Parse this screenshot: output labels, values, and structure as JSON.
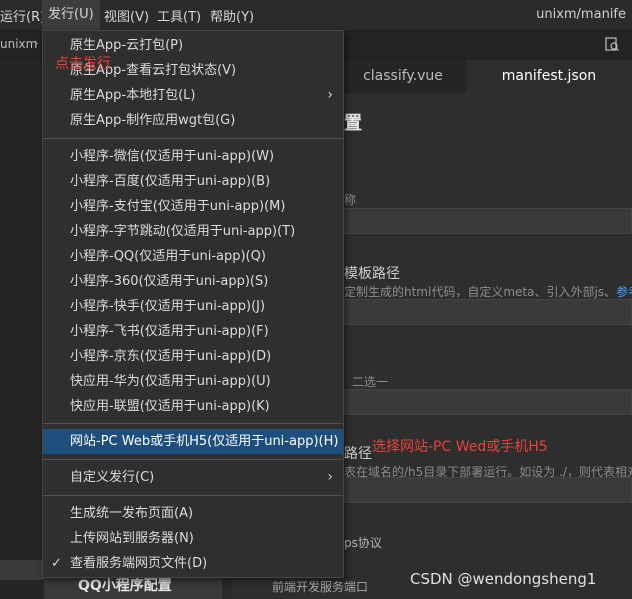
{
  "menubar": {
    "items": [
      "运行(R)",
      "发行(U)",
      "视图(V)",
      "工具(T)",
      "帮助(Y)"
    ],
    "window_title": "unixm/manife"
  },
  "breadcrumb": {
    "root": "unixm"
  },
  "tabs": [
    "classify.vue",
    "manifest.json"
  ],
  "dropdown": {
    "items": [
      "原生App-云打包(P)",
      "原生App-查看云打包状态(V)",
      "原生App-本地打包(L)",
      "原生App-制作应用wgt包(G)",
      "小程序-微信(仅适用于uni-app)(W)",
      "小程序-百度(仅适用于uni-app)(B)",
      "小程序-支付宝(仅适用于uni-app)(M)",
      "小程序-字节跳动(仅适用于uni-app)(T)",
      "小程序-QQ(仅适用于uni-app)(Q)",
      "小程序-360(仅适用于uni-app)(S)",
      "小程序-快手(仅适用于uni-app)(J)",
      "小程序-飞书(仅适用于uni-app)(F)",
      "小程序-京东(仅适用于uni-app)(D)",
      "快应用-华为(仅适用于uni-app)(U)",
      "快应用-联盟(仅适用于uni-app)(K)",
      "网站-PC Web或手机H5(仅适用于uni-app)(H)",
      "自定义发行(C)",
      "生成统一发布页面(A)",
      "上传网站到服务器(N)",
      "查看服务端网页文件(D)"
    ],
    "check_glyph": "✓",
    "submenu_glyph": "›"
  },
  "annotations": {
    "publish": "点击发行",
    "select": "选择网站-PC Wed或手机H5"
  },
  "background": {
    "heading": "置",
    "name_hint": "称",
    "template_title": "模板路径",
    "template_desc": "定制生成的html代码，自定义meta、引入外部js、",
    "template_link": "参考",
    "choose_one": "二选一",
    "path_title": "路径",
    "path_desc": "表在域名的/h5目录下部署运行。如设为 ./，则代表相对",
    "https_label": "ps协议",
    "port_label": "前端开发服务端口",
    "qq_config": "QQ小程序配置"
  },
  "watermark": "CSDN @wendongsheng1",
  "colors": {
    "highlight": "#1e4f7c",
    "annotation": "#e8423c",
    "link": "#4aa3ff"
  }
}
